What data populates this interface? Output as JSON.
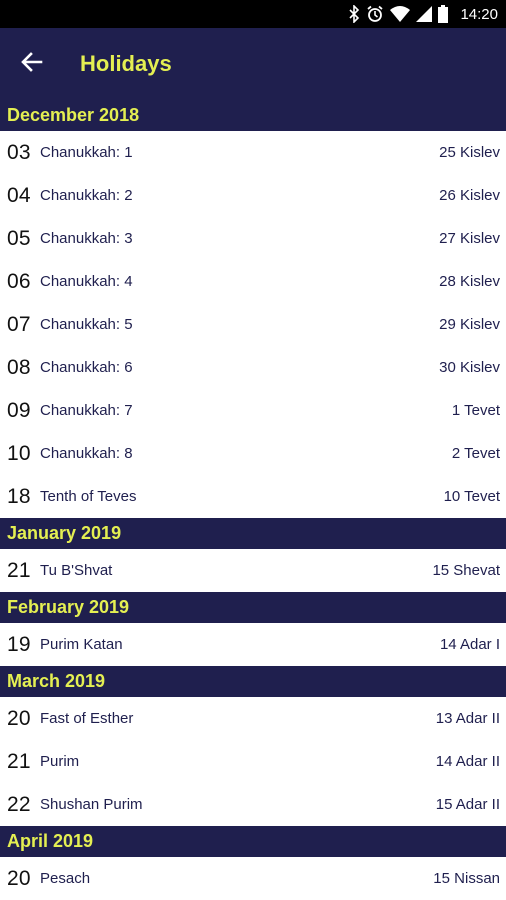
{
  "status_bar": {
    "time": "14:20",
    "icons": [
      "bluetooth-icon",
      "alarm-icon",
      "wifi-icon",
      "signal-icon",
      "battery-icon"
    ]
  },
  "app_bar": {
    "title": "Holidays",
    "back_icon": "arrow-left-icon"
  },
  "colors": {
    "primary": "#1f1f4e",
    "accent": "#e4ef52",
    "text": "#1f1f4e"
  },
  "sections": [
    {
      "month": "December 2018",
      "items": [
        {
          "day": "03",
          "name": "Chanukkah: 1",
          "hebrew": "25 Kislev"
        },
        {
          "day": "04",
          "name": "Chanukkah: 2",
          "hebrew": "26 Kislev"
        },
        {
          "day": "05",
          "name": "Chanukkah: 3",
          "hebrew": "27 Kislev"
        },
        {
          "day": "06",
          "name": "Chanukkah: 4",
          "hebrew": "28 Kislev"
        },
        {
          "day": "07",
          "name": "Chanukkah: 5",
          "hebrew": "29 Kislev"
        },
        {
          "day": "08",
          "name": "Chanukkah: 6",
          "hebrew": "30 Kislev"
        },
        {
          "day": "09",
          "name": "Chanukkah: 7",
          "hebrew": "1 Tevet"
        },
        {
          "day": "10",
          "name": "Chanukkah: 8",
          "hebrew": "2 Tevet"
        },
        {
          "day": "18",
          "name": "Tenth of Teves",
          "hebrew": "10 Tevet"
        }
      ]
    },
    {
      "month": "January 2019",
      "items": [
        {
          "day": "21",
          "name": "Tu B'Shvat",
          "hebrew": "15 Shevat"
        }
      ]
    },
    {
      "month": "February 2019",
      "items": [
        {
          "day": "19",
          "name": "Purim Katan",
          "hebrew": "14 Adar I"
        }
      ]
    },
    {
      "month": "March 2019",
      "items": [
        {
          "day": "20",
          "name": "Fast of Esther",
          "hebrew": "13 Adar II"
        },
        {
          "day": "21",
          "name": "Purim",
          "hebrew": "14 Adar II"
        },
        {
          "day": "22",
          "name": "Shushan Purim",
          "hebrew": "15 Adar II"
        }
      ]
    },
    {
      "month": "April 2019",
      "items": [
        {
          "day": "20",
          "name": "Pesach",
          "hebrew": "15 Nissan"
        }
      ]
    }
  ]
}
